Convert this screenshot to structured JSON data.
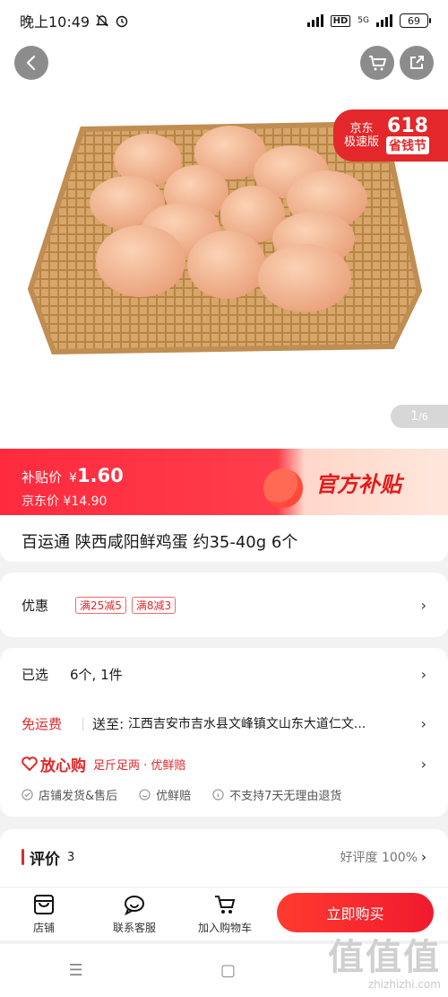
{
  "status_bar": {
    "time": "晚上10:49",
    "network": "5G",
    "hd": "HD",
    "battery": "69"
  },
  "hero": {
    "promo": {
      "brand_line1": "京东",
      "brand_line2": "极速版",
      "number": "618",
      "subtitle": "省钱节"
    },
    "pager": {
      "current": "1",
      "total": "/6"
    }
  },
  "price": {
    "subsidy_label": "补贴价",
    "currency": "¥",
    "subsidy_value": "1.60",
    "jd_label": "京东价",
    "jd_value": "¥14.90",
    "badge": "官方补贴"
  },
  "product": {
    "title": "百运通 陕西咸阳鲜鸡蛋  约35-40g 6个"
  },
  "discount": {
    "label": "优惠",
    "tags": [
      "满25减5",
      "满8减3"
    ]
  },
  "selection": {
    "label": "已选",
    "value": "6个, 1件"
  },
  "shipping": {
    "label": "免运费",
    "prefix": "送至: ",
    "address": "江西吉安市吉水县文峰镇文山东大道仁文..."
  },
  "assurance": {
    "title": "放心购",
    "desc": "足斤足两 · 优鲜赔",
    "items": [
      "店铺发货&售后",
      "优鲜赔",
      "不支持7天无理由退货"
    ]
  },
  "reviews": {
    "label": "评价",
    "count": "3",
    "rating_label": "好评度",
    "rating": "100%"
  },
  "bottom_bar": {
    "shop": "店铺",
    "service": "联系客服",
    "add_cart": "加入购物车",
    "buy": "立即购买"
  },
  "watermark": {
    "text": "值值值",
    "domain": "zhizhizhi.com"
  },
  "colors": {
    "accent": "#e3272a",
    "banner": "#ff2a3e"
  }
}
